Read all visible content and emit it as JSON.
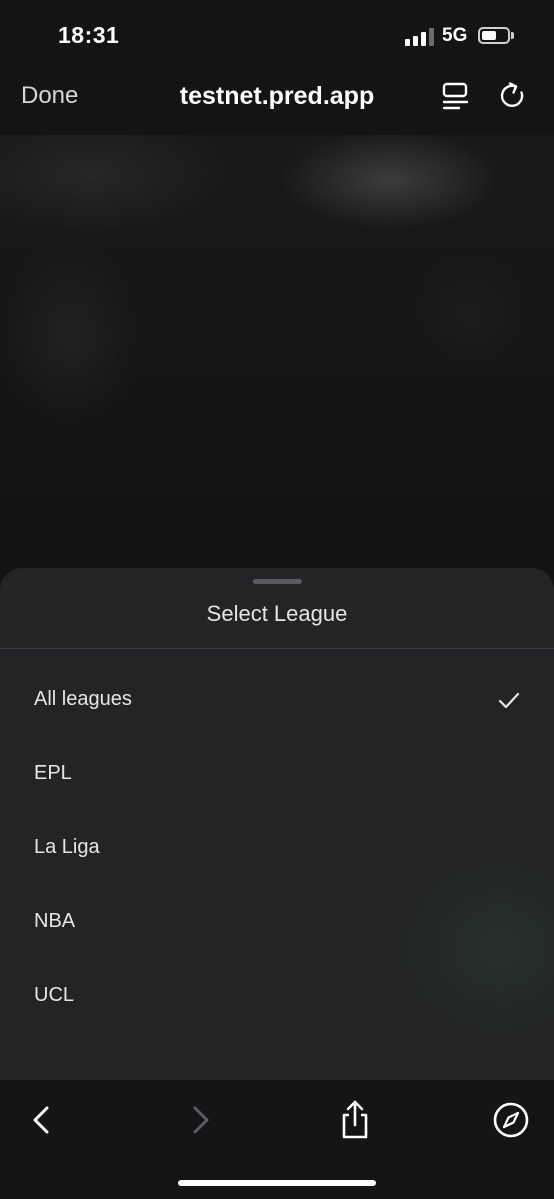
{
  "status_bar": {
    "time": "18:31",
    "network": "5G",
    "signal_bars_active": 3,
    "battery_level": 0.6
  },
  "browser": {
    "done_label": "Done",
    "url": "testnet.pred.app",
    "reader_icon": "reader-view-icon",
    "reload_icon": "reload-icon"
  },
  "sheet": {
    "title": "Select League",
    "selected_index": 0,
    "items": [
      {
        "label": "All leagues"
      },
      {
        "label": "EPL"
      },
      {
        "label": "La Liga"
      },
      {
        "label": "NBA"
      },
      {
        "label": "UCL"
      }
    ]
  },
  "toolbar": {
    "icons": [
      "back-icon",
      "forward-icon",
      "share-icon",
      "compass-icon"
    ]
  },
  "colors": {
    "sheet_background": "#232426",
    "header_background": "#121415",
    "text_primary": "#e6e6e6"
  }
}
